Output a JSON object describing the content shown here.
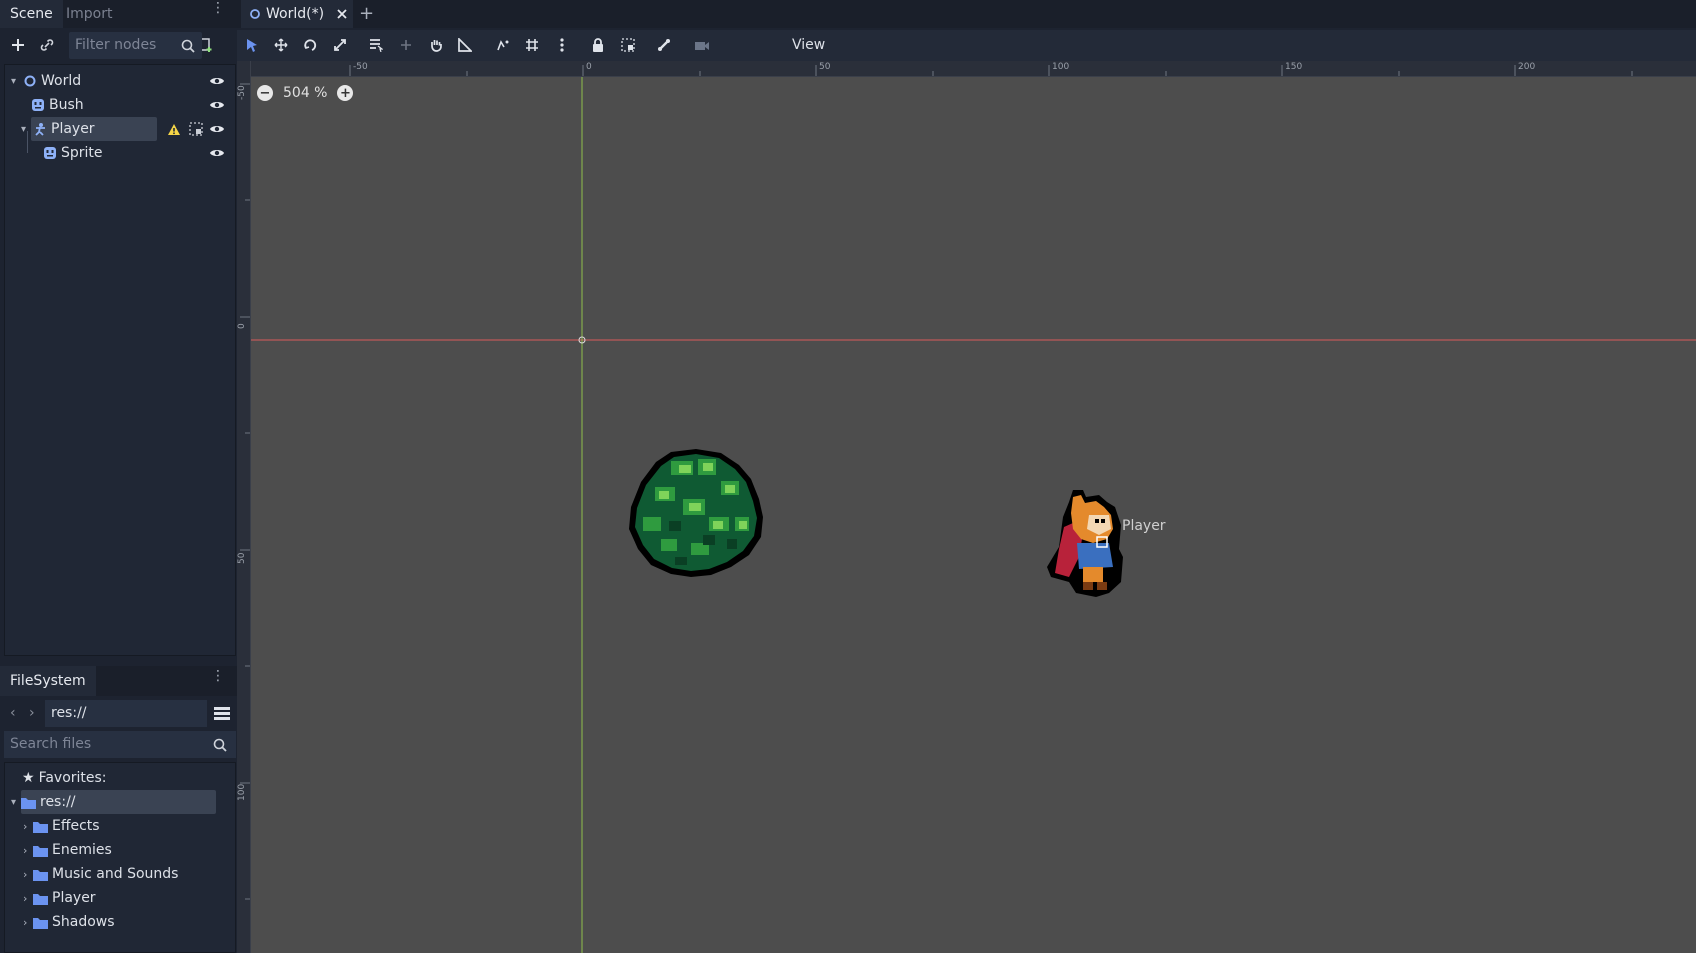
{
  "scene_dock": {
    "tabs": [
      "Scene",
      "Import"
    ],
    "filter_placeholder": "Filter nodes",
    "nodes": [
      {
        "name": "World",
        "icon": "node2d-icon"
      },
      {
        "name": "Bush",
        "icon": "sprite-icon"
      },
      {
        "name": "Player",
        "icon": "kinematic-body-icon"
      },
      {
        "name": "Sprite",
        "icon": "sprite-icon"
      }
    ]
  },
  "filesystem": {
    "tab": "FileSystem",
    "path": "res://",
    "search_placeholder": "Search files",
    "favorites_label": "Favorites:",
    "root": "res://",
    "folders": [
      "Effects",
      "Enemies",
      "Music and Sounds",
      "Player",
      "Shadows"
    ]
  },
  "editor": {
    "document_tab": "World(*)",
    "view_menu": "View",
    "zoom": "504 %",
    "ruler_top": [
      "-50",
      "0",
      "50",
      "100",
      "150",
      "200"
    ],
    "ruler_left": [
      "-50",
      "0",
      "50",
      "100"
    ],
    "canvas_player_label": "Player"
  },
  "colors": {
    "accent": "#6b93f0",
    "axis_x": "#e05050",
    "axis_y": "#7fbf3f",
    "viewport_bg": "#4d4d4d",
    "warning": "#f5d547"
  }
}
